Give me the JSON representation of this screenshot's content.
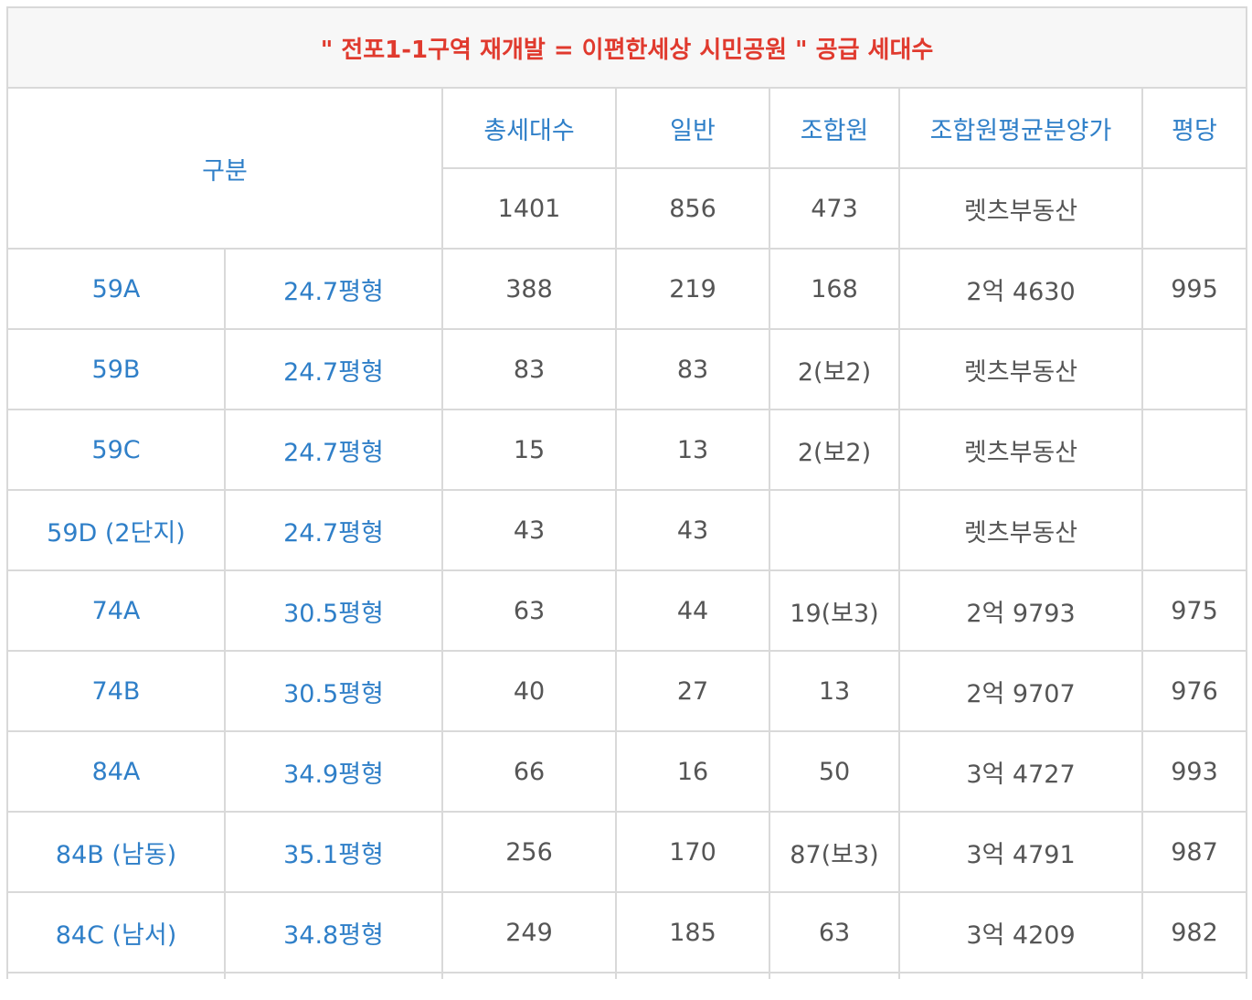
{
  "table": {
    "title": "\" 전포1-1구역 재개발 = 이편한세상 시민공원 \" 공급 세대수",
    "header": {
      "category": "구분",
      "columns": [
        "총세대수",
        "일반",
        "조합원",
        "조합원평균분양가",
        "평당"
      ]
    },
    "totals": {
      "total_units": "1401",
      "general": "856",
      "members": "473",
      "avg_price": "렛츠부동산",
      "per_pyeong": ""
    },
    "rows": [
      {
        "type": "59A",
        "size": "24.7평형",
        "total": "388",
        "general": "219",
        "members": "168",
        "avg_price": "2억 4630",
        "per_pyeong": "995"
      },
      {
        "type": "59B",
        "size": "24.7평형",
        "total": "83",
        "general": "83",
        "members": "2(보2)",
        "avg_price": "렛츠부동산",
        "per_pyeong": ""
      },
      {
        "type": "59C",
        "size": "24.7평형",
        "total": "15",
        "general": "13",
        "members": "2(보2)",
        "avg_price": "렛츠부동산",
        "per_pyeong": ""
      },
      {
        "type": "59D (2단지)",
        "size": "24.7평형",
        "total": "43",
        "general": "43",
        "members": "",
        "avg_price": "렛츠부동산",
        "per_pyeong": ""
      },
      {
        "type": "74A",
        "size": "30.5평형",
        "total": "63",
        "general": "44",
        "members": "19(보3)",
        "avg_price": "2억 9793",
        "per_pyeong": "975"
      },
      {
        "type": "74B",
        "size": "30.5평형",
        "total": "40",
        "general": "27",
        "members": "13",
        "avg_price": "2억 9707",
        "per_pyeong": "976"
      },
      {
        "type": "84A",
        "size": "34.9평형",
        "total": "66",
        "general": "16",
        "members": "50",
        "avg_price": "3억 4727",
        "per_pyeong": "993"
      },
      {
        "type": "84B (남동)",
        "size": "35.1평형",
        "total": "256",
        "general": "170",
        "members": "87(보3)",
        "avg_price": "3억 4791",
        "per_pyeong": "987"
      },
      {
        "type": "84C (남서)",
        "size": "34.8평형",
        "total": "249",
        "general": "185",
        "members": "63",
        "avg_price": "3억 4209",
        "per_pyeong": "982"
      }
    ]
  }
}
